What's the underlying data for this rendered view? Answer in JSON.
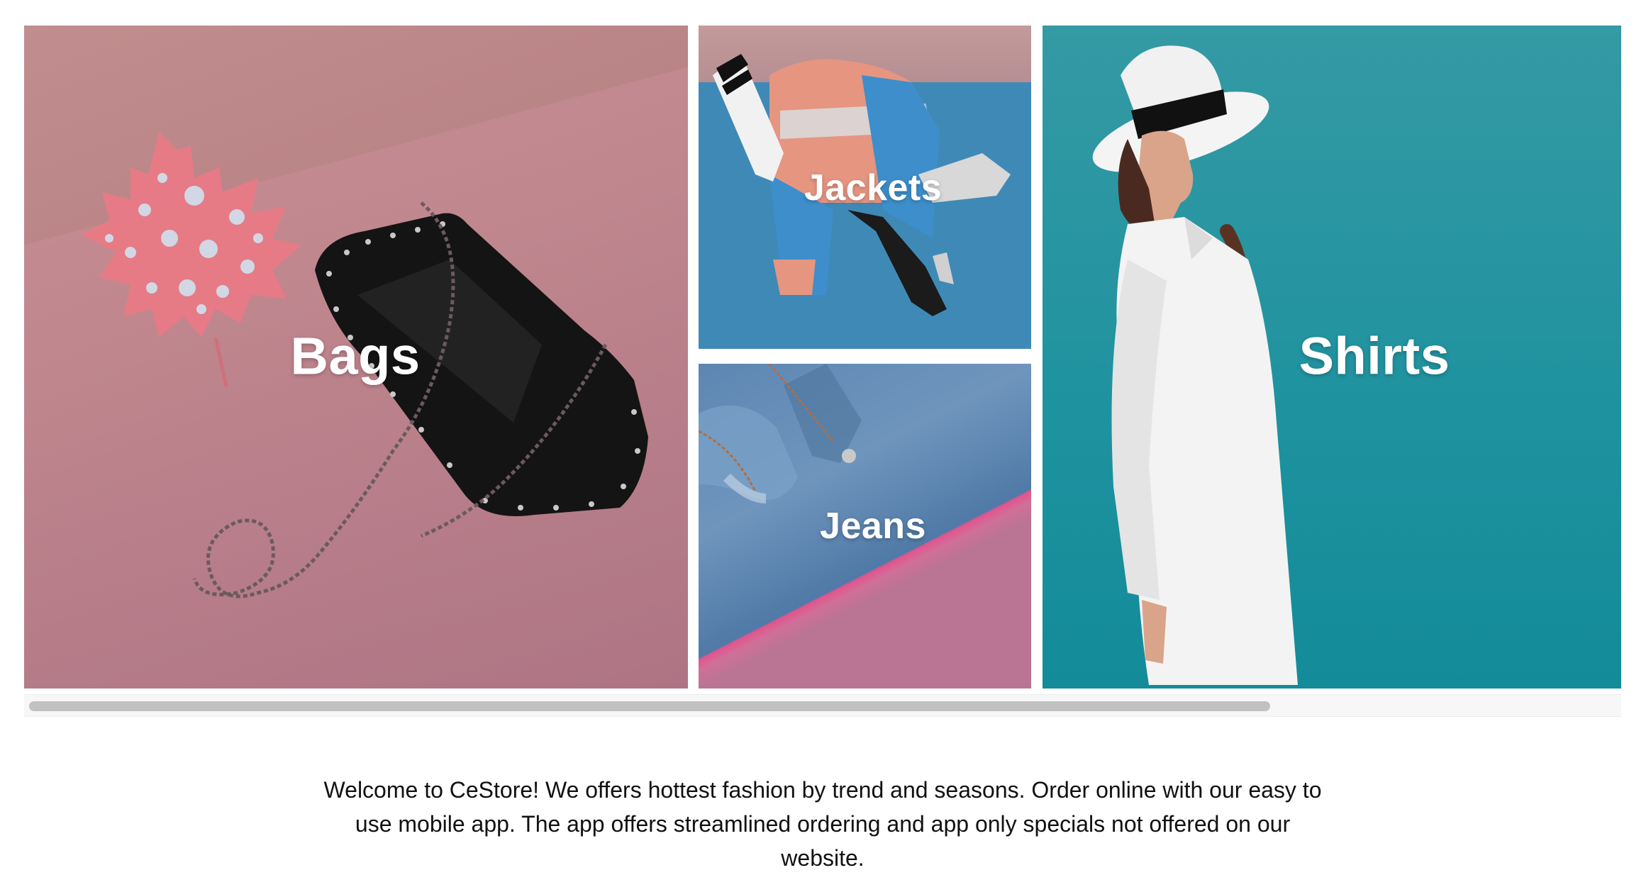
{
  "categories": {
    "bags": {
      "label": "Bags"
    },
    "jackets": {
      "label": "Jackets"
    },
    "jeans": {
      "label": "Jeans"
    },
    "shirts": {
      "label": "Shirts"
    }
  },
  "colors": {
    "bags_bg": "#b88284",
    "jackets_bg": "#3f89b7",
    "jeans_bg": "#b97593",
    "shirts_bg": "#1e929f",
    "label_text": "#ffffff",
    "body_text": "#111111"
  },
  "scrollbar": {
    "position_fraction": 0.0,
    "visible_fraction": 0.78
  },
  "welcome_text": "Welcome to CeStore! We offers hottest fashion by trend and seasons. Order online with our easy to use mobile app. The app offers streamlined ordering and app only specials not offered on our website."
}
